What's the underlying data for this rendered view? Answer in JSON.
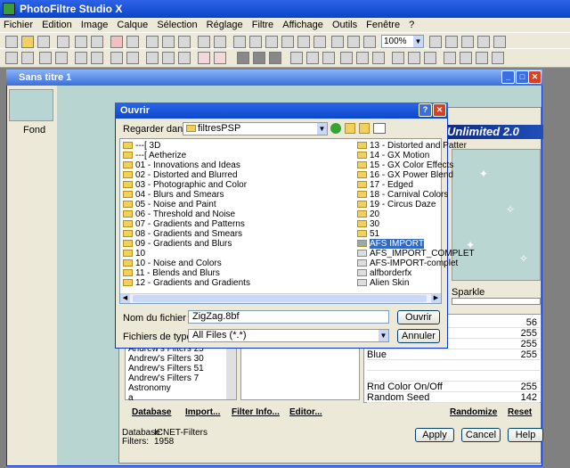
{
  "app": {
    "title": "PhotoFiltre Studio X"
  },
  "menu": [
    "Fichier",
    "Edition",
    "Image",
    "Calque",
    "Sélection",
    "Réglage",
    "Filtre",
    "Affichage",
    "Outils",
    "Fenêtre",
    "?"
  ],
  "toolbar": {
    "zoom": "100%"
  },
  "document": {
    "title": "Sans titre 1",
    "layer_label": "Fond"
  },
  "filter_dialog": {
    "banner": "Unlimited 2.0",
    "sparkle_label": "Sparkle",
    "params": [
      {
        "name": "",
        "value": "56"
      },
      {
        "name": "",
        "value": "255"
      },
      {
        "name": "",
        "value": "255"
      },
      {
        "name": "Blue",
        "value": "255"
      },
      {
        "name": "",
        "value": ""
      },
      {
        "name": "",
        "value": ""
      },
      {
        "name": "Rnd Color On/Off",
        "value": "255"
      },
      {
        "name": "Random Seed",
        "value": "142"
      }
    ],
    "tree_items": [
      "Andrew's Filters 25",
      "Andrew's Filters 30",
      "Andrew's Filters 51",
      "Andrew's Filters 7",
      "Astronomy",
      "a"
    ],
    "links": {
      "database": "Database",
      "import": "Import...",
      "filter_info": "Filter Info...",
      "editor": "Editor...",
      "randomize": "Randomize",
      "reset": "Reset"
    },
    "status": {
      "database_label": "Database:",
      "database_value": "ICNET-Filters",
      "filters_label": "Filters:",
      "filters_value": "1958"
    },
    "buttons": {
      "apply": "Apply",
      "cancel": "Cancel",
      "help": "Help"
    }
  },
  "open_dialog": {
    "title": "Ouvrir",
    "lookin_label": "Regarder dans :",
    "lookin_value": "filtresPSP",
    "left_column": [
      "---[ 3D",
      "---[ Aetherize",
      "01 - Innovations and Ideas",
      "02 - Distorted and Blurred",
      "03 - Photographic and Color",
      "04 - Blurs and Smears",
      "05 - Noise and Paint",
      "06 - Threshold and Noise",
      "07 - Gradients and Patterns",
      "08 - Gradients and Smears",
      "09 - Gradients and Blurs",
      "10",
      "10 - Noise and Colors",
      "11 - Blends and Blurs",
      "12 - Gradients and Gradients"
    ],
    "right_column": [
      "13 - Distorted and Patter",
      "14 - GX Motion",
      "15 - GX Color Effects",
      "16 - GX Power Blend",
      "17 - Edged",
      "18 - Carnival Colors",
      "19 - Circus Daze",
      "20",
      "30",
      "51",
      "AFS IMPORT",
      "AFS_IMPORT_COMPLET",
      "AFS-IMPORT-complet",
      "alfborderfx",
      "Alien Skin"
    ],
    "selected_item": "AFS IMPORT",
    "filename_label": "Nom du fichier :",
    "filename_value": "ZigZag.8bf",
    "filetype_label": "Fichiers de type :",
    "filetype_value": "All Files (*.*)",
    "open_button": "Ouvrir",
    "cancel_button": "Annuler"
  }
}
